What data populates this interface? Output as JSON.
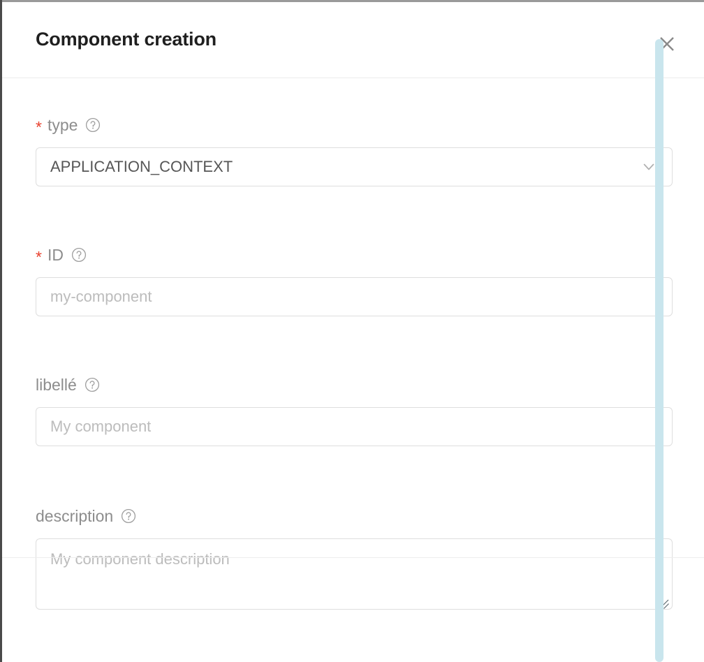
{
  "dialog": {
    "title": "Component creation",
    "close_icon": "close-icon",
    "accent_scrollbar_color": "#c9e5ed",
    "required_marker": "*",
    "required_marker_color": "#e8412e"
  },
  "form": {
    "fields": [
      {
        "name": "type",
        "label": "type",
        "required": true,
        "help_icon": "help-circle-icon",
        "control": "select",
        "value": "APPLICATION_CONTEXT",
        "chevron_icon": "chevron-down-icon"
      },
      {
        "name": "id",
        "label": "ID",
        "required": true,
        "help_icon": "help-circle-icon",
        "control": "text",
        "value": "",
        "placeholder": "my-component"
      },
      {
        "name": "libelle",
        "label": "libellé",
        "required": false,
        "help_icon": "help-circle-icon",
        "control": "text",
        "value": "",
        "placeholder": "My component"
      },
      {
        "name": "description",
        "label": "description",
        "required": false,
        "help_icon": "help-circle-icon",
        "control": "textarea",
        "value": "",
        "placeholder": "My component description",
        "resize_handle": "resize-grip-icon"
      }
    ]
  }
}
